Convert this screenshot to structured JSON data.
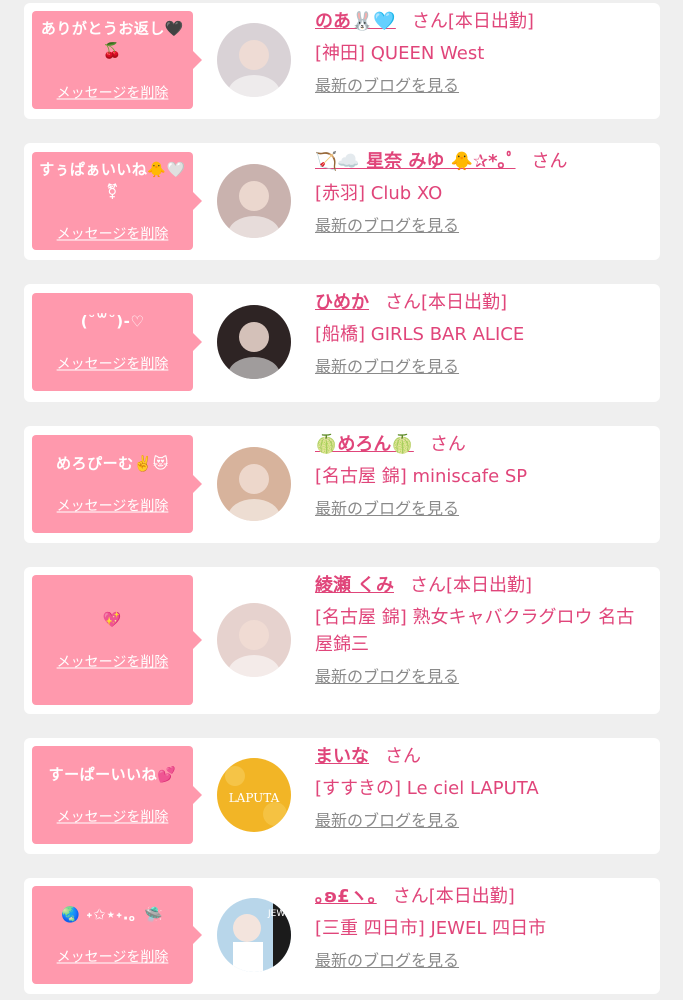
{
  "items": [
    {
      "message": "ありがとうお返し🖤🍒",
      "delete_label": "メッセージを削除",
      "name": "のあ🐰🩵",
      "honorific": "さん",
      "attendance": "[本日出勤]",
      "shop": "[神田] QUEEN West",
      "blog_link": "最新のブログを見る",
      "avatar_color": "#d9d2d6"
    },
    {
      "message": "すぅぱぁいいね🐥🤍⚧",
      "delete_label": "メッセージを削除",
      "name": "🏹☁️ 星奈 みゆ 🐥✰*｡ﾟ",
      "honorific": "さん",
      "attendance": "",
      "shop": "[赤羽] Club XO",
      "blog_link": "最新のブログを見る",
      "avatar_color": "#c9b2ae"
    },
    {
      "message": "(˘꒳˘)-♡",
      "delete_label": "メッセージを削除",
      "name": "ひめか",
      "honorific": "さん",
      "attendance": "[本日出勤]",
      "shop": "[船橋] GIRLS BAR ALICE",
      "blog_link": "最新のブログを見る",
      "avatar_color": "#2e2424"
    },
    {
      "message": "めろぴーむ✌️😻",
      "delete_label": "メッセージを削除",
      "name": "🍈めろん🍈",
      "honorific": "さん",
      "attendance": "",
      "shop": "[名古屋 錦] miniscafe SP",
      "blog_link": "最新のブログを見る",
      "avatar_color": "#d7b39c"
    },
    {
      "message": "💖",
      "delete_label": "メッセージを削除",
      "name": "綾瀬 くみ",
      "honorific": "さん",
      "attendance": "[本日出勤]",
      "shop": "[名古屋 錦] 熟女キャバクラグロウ 名古屋錦三",
      "blog_link": "最新のブログを見る",
      "avatar_color": "#e6d2ce"
    },
    {
      "message": "すーぱーいいね💕",
      "delete_label": "メッセージを削除",
      "name": "まいな",
      "honorific": "さん",
      "attendance": "",
      "shop": "[すすきの] Le ciel LAPUTA",
      "blog_link": "最新のブログを見る",
      "avatar_color": "#f2b526",
      "avatar_text": "LAPUTA"
    },
    {
      "message": "🌏 ˖✩⋆˖.。🛸",
      "delete_label": "メッセージを削除",
      "name": "｡ʚ£ヽ｡",
      "honorific": "さん",
      "attendance": "[本日出勤]",
      "shop": "[三重 四日市] JEWEL 四日市",
      "blog_link": "最新のブログを見る",
      "avatar_color": "#b8d6ea",
      "avatar_text": "JEWEL"
    }
  ],
  "colors": {
    "accent": "#e0457a",
    "bubble": "#ff99ad",
    "background": "#efefef",
    "card": "#ffffff",
    "muted": "#8a8a8a"
  }
}
